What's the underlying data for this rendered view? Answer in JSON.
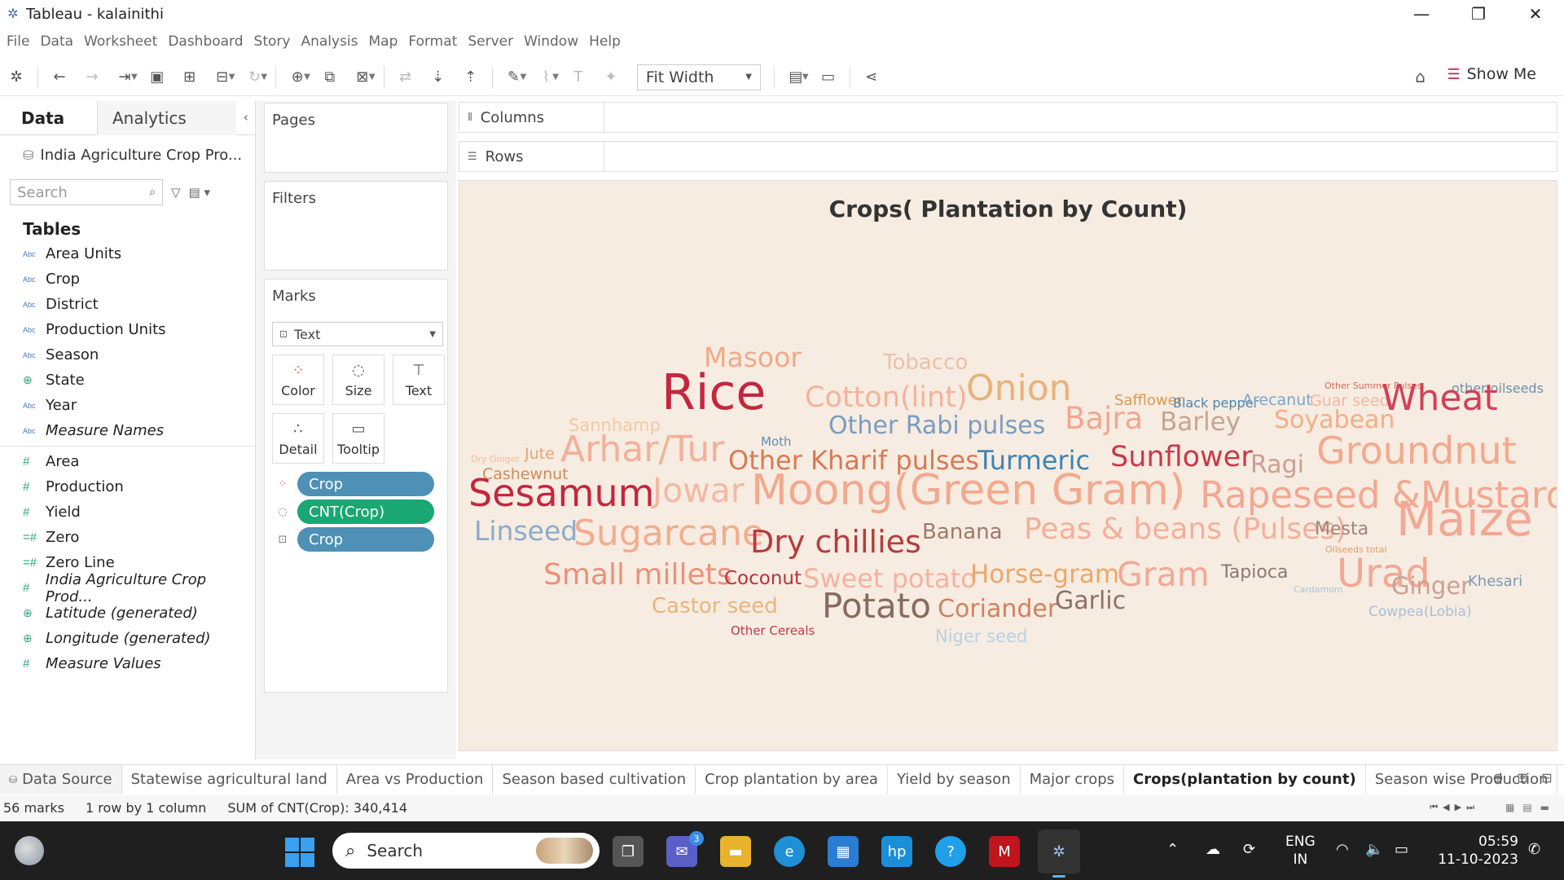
{
  "window": {
    "title": "Tableau - kalainithi",
    "controls": [
      "—",
      "❐",
      "✕"
    ]
  },
  "menu": [
    "File",
    "Data",
    "Worksheet",
    "Dashboard",
    "Story",
    "Analysis",
    "Map",
    "Format",
    "Server",
    "Window",
    "Help"
  ],
  "toolbar": {
    "fit": "Fit Width",
    "show_me": "Show Me"
  },
  "data_pane": {
    "tabs": [
      "Data",
      "Analytics"
    ],
    "datasource": "India Agriculture Crop Pro...",
    "search_placeholder": "Search",
    "tables_label": "Tables",
    "dimensions": [
      {
        "type": "Abc",
        "label": "Area Units"
      },
      {
        "type": "Abc",
        "label": "Crop"
      },
      {
        "type": "Abc",
        "label": "District"
      },
      {
        "type": "Abc",
        "label": "Production Units"
      },
      {
        "type": "Abc",
        "label": "Season"
      },
      {
        "type": "⊕",
        "label": "State"
      },
      {
        "type": "Abc",
        "label": "Year"
      },
      {
        "type": "Abc",
        "label": "Measure Names"
      }
    ],
    "measures": [
      {
        "type": "#",
        "label": "Area"
      },
      {
        "type": "#",
        "label": "Production"
      },
      {
        "type": "#",
        "label": "Yield"
      },
      {
        "type": "=#",
        "label": "Zero"
      },
      {
        "type": "=#",
        "label": "Zero Line"
      },
      {
        "type": "#",
        "label": "India Agriculture Crop Prod..."
      },
      {
        "type": "⊕",
        "label": "Latitude (generated)"
      },
      {
        "type": "⊕",
        "label": "Longitude (generated)"
      },
      {
        "type": "#",
        "label": "Measure Values"
      }
    ]
  },
  "cards": {
    "pages": "Pages",
    "filters": "Filters",
    "marks": "Marks",
    "mark_type": "Text",
    "mark_buttons": [
      "Color",
      "Size",
      "Text",
      "Detail",
      "Tooltip"
    ],
    "pills": [
      "Crop",
      "CNT(Crop)",
      "Crop"
    ]
  },
  "shelves": {
    "columns": "Columns",
    "rows": "Rows"
  },
  "viz": {
    "title": "Crops( Plantation by Count)",
    "words": [
      {
        "text": "Masoor",
        "size": 33,
        "color": "#f2a98a",
        "weight": "normal"
      },
      {
        "text": "Tobacco",
        "size": 26,
        "color": "#e9c1ab",
        "weight": "normal"
      },
      {
        "text": "Other Summer Pulses",
        "size": 11,
        "color": "#d66a5a",
        "weight": "normal"
      },
      {
        "text": "other oilseeds",
        "size": 16,
        "color": "#6d8fa8",
        "weight": "normal"
      },
      {
        "text": "Rice",
        "size": 60,
        "color": "#c2273f",
        "weight": "normal"
      },
      {
        "text": "Cotton(lint)",
        "size": 35,
        "color": "#f2b39a",
        "weight": "normal"
      },
      {
        "text": "Onion",
        "size": 44,
        "color": "#e8b27a",
        "weight": "normal"
      },
      {
        "text": "Safflower",
        "size": 18,
        "color": "#d99a52",
        "weight": "normal"
      },
      {
        "text": "Black pepper",
        "size": 16,
        "color": "#4a86b0",
        "weight": "normal"
      },
      {
        "text": "Arecanut",
        "size": 19,
        "color": "#7ba4c8",
        "weight": "normal"
      },
      {
        "text": "Guar seed",
        "size": 19,
        "color": "#f3b7a0",
        "weight": "normal"
      },
      {
        "text": "Wheat",
        "size": 44,
        "color": "#d0415a",
        "weight": "normal"
      },
      {
        "text": "Sannhamp",
        "size": 21,
        "color": "#f3c8a2",
        "weight": "normal"
      },
      {
        "text": "Moth",
        "size": 15,
        "color": "#5f8fb8",
        "weight": "normal"
      },
      {
        "text": "Other Rabi pulses",
        "size": 30,
        "color": "#7a9cc0",
        "weight": "normal"
      },
      {
        "text": "Bajra",
        "size": 37,
        "color": "#f2a690",
        "weight": "normal"
      },
      {
        "text": "Barley",
        "size": 31,
        "color": "#c5a494",
        "weight": "normal"
      },
      {
        "text": "Soyabean",
        "size": 30,
        "color": "#f2ae88",
        "weight": "normal"
      },
      {
        "text": "Dry Ginger",
        "size": 11,
        "color": "#f2b8a0",
        "weight": "normal"
      },
      {
        "text": "Jute",
        "size": 19,
        "color": "#e4a672",
        "weight": "normal"
      },
      {
        "text": "Arhar/Tur",
        "size": 44,
        "color": "#f2b09a",
        "weight": "normal"
      },
      {
        "text": "Other Kharif pulses",
        "size": 32,
        "color": "#d77a56",
        "weight": "normal"
      },
      {
        "text": "Turmeric",
        "size": 32,
        "color": "#3f82b4",
        "weight": "normal"
      },
      {
        "text": "Sunflower",
        "size": 35,
        "color": "#c73a4a",
        "weight": "normal"
      },
      {
        "text": "Ragi",
        "size": 30,
        "color": "#c9a092",
        "weight": "normal"
      },
      {
        "text": "Groundnut",
        "size": 46,
        "color": "#f3a98e",
        "weight": "normal"
      },
      {
        "text": "Cashewnut",
        "size": 19,
        "color": "#d08a5c",
        "weight": "normal"
      },
      {
        "text": "Sesamum",
        "size": 46,
        "color": "#c3273d",
        "weight": "normal"
      },
      {
        "text": "Jowar",
        "size": 41,
        "color": "#f2b9a2",
        "weight": "normal"
      },
      {
        "text": "Moong(Green Gram)",
        "size": 52,
        "color": "#f2a98e",
        "weight": "normal"
      },
      {
        "text": "Rapeseed &Mustard",
        "size": 45,
        "color": "#f2a892",
        "weight": "normal"
      },
      {
        "text": "Linseed",
        "size": 33,
        "color": "#8aaccb",
        "weight": "normal"
      },
      {
        "text": "Sugarcane",
        "size": 44,
        "color": "#f2ac90",
        "weight": "normal"
      },
      {
        "text": "Dry chillies",
        "size": 38,
        "color": "#b43c3e",
        "weight": "normal"
      },
      {
        "text": "Banana",
        "size": 26,
        "color": "#a07a6c",
        "weight": "normal"
      },
      {
        "text": "Peas & beans (Pulses)",
        "size": 36,
        "color": "#f2b09a",
        "weight": "normal"
      },
      {
        "text": "Mesta",
        "size": 22,
        "color": "#a0857a",
        "weight": "normal"
      },
      {
        "text": "Oilseeds total",
        "size": 11,
        "color": "#e09a6a",
        "weight": "normal"
      },
      {
        "text": "Maize",
        "size": 58,
        "color": "#f2a895",
        "weight": "normal"
      },
      {
        "text": "Small millets",
        "size": 36,
        "color": "#e9927a",
        "weight": "normal"
      },
      {
        "text": "Coconut",
        "size": 23,
        "color": "#b3343c",
        "weight": "normal"
      },
      {
        "text": "Sweet potato",
        "size": 32,
        "color": "#f3b3a0",
        "weight": "normal"
      },
      {
        "text": "Horse-gram",
        "size": 31,
        "color": "#e9a86a",
        "weight": "normal"
      },
      {
        "text": "Gram",
        "size": 41,
        "color": "#f2a896",
        "weight": "normal"
      },
      {
        "text": "Tapioca",
        "size": 22,
        "color": "#8d7a72",
        "weight": "normal"
      },
      {
        "text": "Cardamom",
        "size": 11,
        "color": "#a8c4dc",
        "weight": "normal"
      },
      {
        "text": "Urad",
        "size": 48,
        "color": "#f2a893",
        "weight": "normal"
      },
      {
        "text": "Ginger",
        "size": 29,
        "color": "#c9a194",
        "weight": "normal"
      },
      {
        "text": "Khesari",
        "size": 18,
        "color": "#7c9ab8",
        "weight": "normal"
      },
      {
        "text": "Castor seed",
        "size": 26,
        "color": "#e9b47c",
        "weight": "normal"
      },
      {
        "text": "Potato",
        "size": 42,
        "color": "#8a6a5e",
        "weight": "normal"
      },
      {
        "text": "Coriander",
        "size": 30,
        "color": "#d08260",
        "weight": "normal"
      },
      {
        "text": "Garlic",
        "size": 30,
        "color": "#8d7266",
        "weight": "normal"
      },
      {
        "text": "Cowpea(Lobia)",
        "size": 17,
        "color": "#a6c0d8",
        "weight": "normal"
      },
      {
        "text": "Other Cereals",
        "size": 15,
        "color": "#c33a4a",
        "weight": "normal"
      },
      {
        "text": "Niger seed",
        "size": 21,
        "color": "#b8d0e4",
        "weight": "normal"
      }
    ]
  },
  "sheet_tabs": [
    "Data Source",
    "Statewise agricultural land",
    "Area vs Production",
    "Season based cultivation",
    "Crop plantation by area",
    "Yield by season",
    "Major crops",
    "Crops(plantation by count)",
    "Season wise Production"
  ],
  "active_tab": "Crops(plantation by count)",
  "status": {
    "marks": "56 marks",
    "rows_cols": "1 row by 1 column",
    "sum": "SUM of CNT(Crop): 340,414"
  },
  "taskbar": {
    "search": "Search",
    "teams_badge": "3",
    "lang_1": "ENG",
    "lang_2": "IN",
    "time": "05:59",
    "date": "11-10-2023"
  }
}
